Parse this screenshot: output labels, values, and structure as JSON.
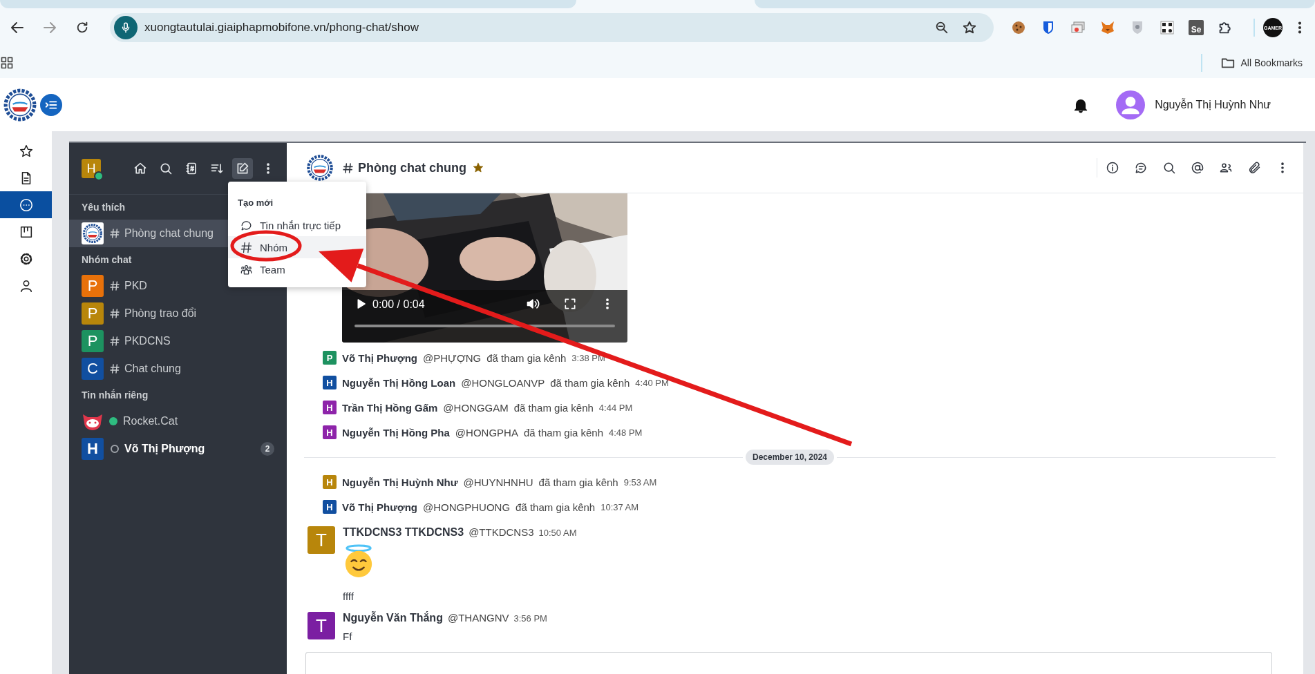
{
  "browser": {
    "url": "xuongtautulai.giaiphapmobifone.vn/phong-chat/show",
    "extensions": [
      {
        "kind": "cookie"
      },
      {
        "kind": "shield"
      },
      {
        "kind": "cards"
      },
      {
        "kind": "fox"
      },
      {
        "kind": "guard"
      },
      {
        "kind": "qr"
      },
      {
        "kind": "se",
        "label": "Se"
      },
      {
        "kind": "puzzle"
      }
    ],
    "profile_label": "GAMER",
    "bookmarks_label": "All Bookmarks"
  },
  "app_header": {
    "user_name": "Nguyễn Thị Huỳnh Như"
  },
  "nav_rail": [
    {
      "kind": "star",
      "selected": false
    },
    {
      "kind": "document",
      "selected": false
    },
    {
      "kind": "chat",
      "selected": true
    },
    {
      "kind": "board",
      "selected": false
    },
    {
      "kind": "settings",
      "selected": false
    },
    {
      "kind": "user",
      "selected": false
    }
  ],
  "sidebar": {
    "user_avatar": {
      "letter": "H",
      "color": "#b8860b",
      "online": true
    },
    "tools": [
      {
        "kind": "home",
        "selected": false
      },
      {
        "kind": "search",
        "selected": false
      },
      {
        "kind": "directory",
        "selected": false
      },
      {
        "kind": "sort",
        "selected": false
      },
      {
        "kind": "compose",
        "selected": true
      },
      {
        "kind": "more",
        "selected": false
      }
    ],
    "sections": [
      {
        "title": "Yêu thích",
        "items": [
          {
            "kind": "channel",
            "label": "Phòng chat chung",
            "avatar": {
              "kind": "logo"
            },
            "selected": true
          }
        ]
      },
      {
        "title": "Nhóm chat",
        "items": [
          {
            "kind": "channel",
            "label": "PKD",
            "avatar": {
              "kind": "letter",
              "letter": "P",
              "color": "#e8710a"
            },
            "selected": false
          },
          {
            "kind": "channel",
            "label": "Phòng trao đổi",
            "avatar": {
              "kind": "letter",
              "letter": "P",
              "color": "#b8860b"
            },
            "selected": false
          },
          {
            "kind": "channel",
            "label": "PKDCNS",
            "avatar": {
              "kind": "letter",
              "letter": "P",
              "color": "#1d9260"
            },
            "selected": false
          },
          {
            "kind": "channel",
            "label": "Chat chung",
            "avatar": {
              "kind": "letter",
              "letter": "C",
              "color": "#114fa0"
            },
            "selected": false
          }
        ]
      },
      {
        "title": "Tin nhắn riêng",
        "items": [
          {
            "kind": "direct",
            "label": "Rocket.Cat",
            "avatar": {
              "kind": "cat"
            },
            "online": true,
            "selected": false
          },
          {
            "kind": "direct",
            "label": "Võ Thị Phượng",
            "avatar": {
              "kind": "letter",
              "letter": "H",
              "color": "#114fa0"
            },
            "online": false,
            "unread": true,
            "badge": "2",
            "selected": false
          }
        ]
      }
    ]
  },
  "menu": {
    "title": "Tạo mới",
    "items": [
      {
        "kind": "direct",
        "label": "Tin nhắn trực tiếp",
        "selected": false
      },
      {
        "kind": "channel",
        "label": "Nhóm",
        "selected": true
      },
      {
        "kind": "team",
        "label": "Team",
        "selected": false
      }
    ]
  },
  "room": {
    "title": "Phòng chat chung",
    "favorite": true,
    "tools": [
      {
        "kind": "info"
      },
      {
        "kind": "threads"
      },
      {
        "kind": "search"
      },
      {
        "kind": "mention"
      },
      {
        "kind": "members"
      },
      {
        "kind": "attach"
      },
      {
        "kind": "more"
      }
    ]
  },
  "video": {
    "time": "0:00 / 0:04",
    "playing": false,
    "level": 0
  },
  "messages": [
    {
      "kind": "system",
      "letter": "P",
      "color": "#1d9260",
      "name": "Võ Thị Phượng",
      "username": "@PHỰỢNG",
      "text": "đã tham gia kênh",
      "time": "3:38 PM"
    },
    {
      "kind": "system",
      "letter": "H",
      "color": "#114fa0",
      "name": "Nguyễn Thị Hồng Loan",
      "username": "@HONGLOANVP",
      "text": "đã tham gia kênh",
      "time": "4:40 PM"
    },
    {
      "kind": "system",
      "letter": "H",
      "color": "#8e24aa",
      "name": "Trần Thị Hồng Gấm",
      "username": "@HONGGAM",
      "text": "đã tham gia kênh",
      "time": "4:44 PM"
    },
    {
      "kind": "system",
      "letter": "H",
      "color": "#8e24aa",
      "name": "Nguyễn Thị Hồng Pha",
      "username": "@HONGPHA",
      "text": "đã tham gia kênh",
      "time": "4:48 PM"
    },
    {
      "kind": "divider",
      "label": "December 10, 2024"
    },
    {
      "kind": "system",
      "letter": "H",
      "color": "#b8860b",
      "name": "Nguyễn Thị Huỳnh Như",
      "username": "@HUYNHNHU",
      "text": "đã tham gia kênh",
      "time": "9:53 AM"
    },
    {
      "kind": "system",
      "letter": "H",
      "color": "#114fa0",
      "name": "Võ Thị Phượng",
      "username": "@HONGPHUONG",
      "text": "đã tham gia kênh",
      "time": "10:37 AM"
    },
    {
      "kind": "message",
      "letter": "T",
      "color": "#b8860b",
      "name": "TTKDCNS3 TTKDCNS3",
      "username": "@TTKDCNS3",
      "time": "10:50 AM",
      "body": [
        {
          "kind": "emoji"
        },
        {
          "kind": "text",
          "text": "ffff"
        }
      ]
    },
    {
      "kind": "message",
      "letter": "T",
      "color": "#7b1fa2",
      "name": "Nguyễn Văn Thắng",
      "username": "@THANGNV",
      "time": "3:56 PM",
      "body": [
        {
          "kind": "text",
          "text": "Ff"
        }
      ]
    }
  ],
  "annotations": [
    {
      "kind": "ellipse"
    },
    {
      "kind": "arrow"
    }
  ]
}
